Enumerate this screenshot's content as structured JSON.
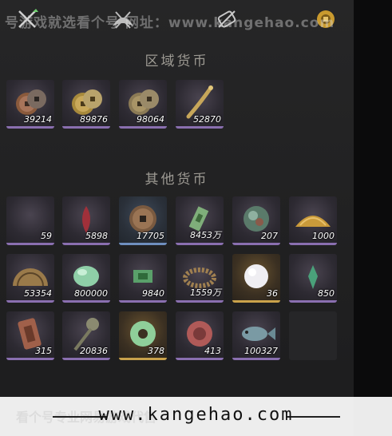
{
  "watermark": {
    "top_text": "号游戏就选看个号  网址：www.kangehao.com",
    "bottom_url": "www.kangehao.com",
    "bottom_ghost": "看个号专业网易游戏代售"
  },
  "icons": [
    "crossed-swords-icon",
    "wings-icon",
    "scroll-icon",
    "coin-badge-icon"
  ],
  "sections": [
    {
      "title": "区域货币",
      "items": [
        {
          "icon": "copper-coins-icon",
          "count": "39214"
        },
        {
          "icon": "gold-coins-icon",
          "count": "89876"
        },
        {
          "icon": "bronze-coins-icon",
          "count": "98064"
        },
        {
          "icon": "coin-string-icon",
          "count": "52870"
        }
      ]
    },
    {
      "title": "其他货币",
      "items": [
        {
          "icon": "moon-jade-icon",
          "count": "59"
        },
        {
          "icon": "red-flame-icon",
          "count": "5898"
        },
        {
          "icon": "square-hole-coin-icon",
          "count": "17705"
        },
        {
          "icon": "banknote-icon",
          "count": "8453万"
        },
        {
          "icon": "jade-orb-icon",
          "count": "207"
        },
        {
          "icon": "grain-pile-icon",
          "count": "1000"
        },
        {
          "icon": "fan-coin-icon",
          "count": "53354"
        },
        {
          "icon": "green-jade-stone-icon",
          "count": "800000"
        },
        {
          "icon": "green-ticket-icon",
          "count": "9840"
        },
        {
          "icon": "coin-chain-icon",
          "count": "1559万"
        },
        {
          "icon": "pearl-icon",
          "count": "36"
        },
        {
          "icon": "green-crystal-icon",
          "count": "850"
        },
        {
          "icon": "copper-token-icon",
          "count": "315"
        },
        {
          "icon": "coin-sword-icon",
          "count": "20836"
        },
        {
          "icon": "jade-ring-icon",
          "count": "378"
        },
        {
          "icon": "red-orb-icon",
          "count": "413"
        },
        {
          "icon": "fish-icon",
          "count": "100327"
        }
      ]
    }
  ]
}
